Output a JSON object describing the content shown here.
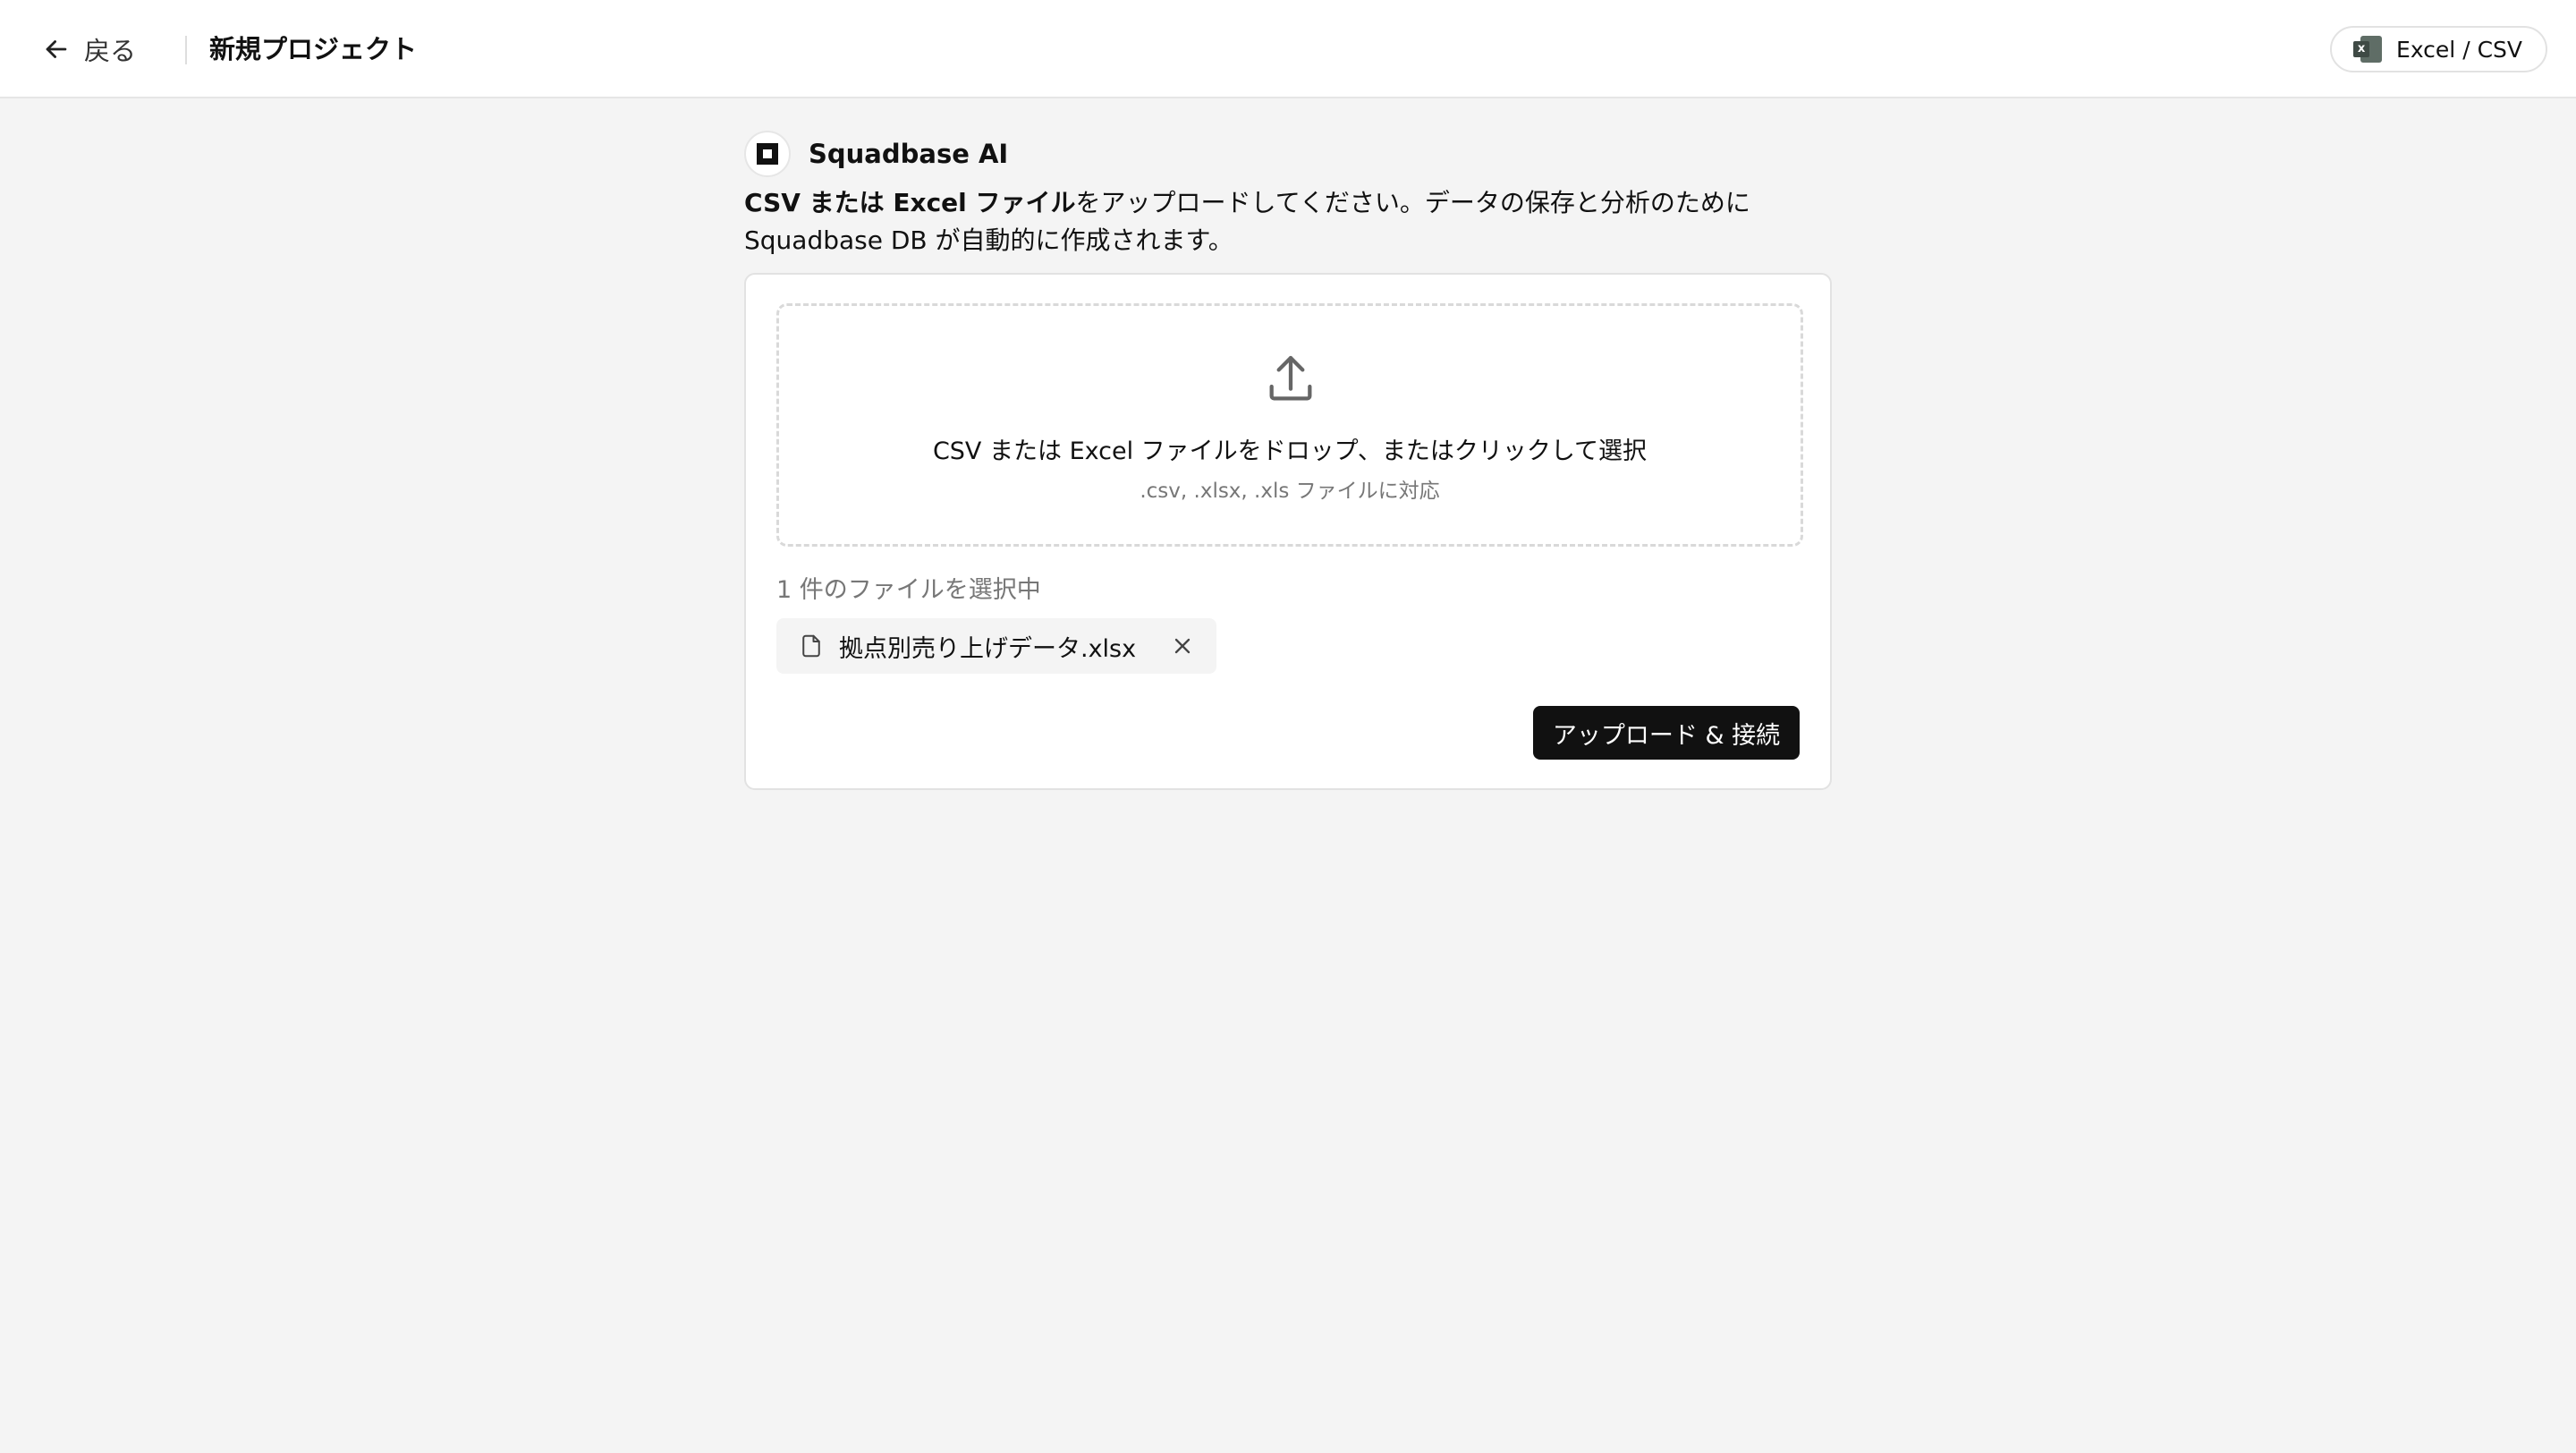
{
  "header": {
    "back_label": "戻る",
    "title": "新規プロジェクト",
    "source_chip": {
      "label": "Excel / CSV",
      "icon": "excel-icon"
    }
  },
  "assistant": {
    "name": "Squadbase AI",
    "message_bold": "CSV または Excel ファイル",
    "message_rest_line1": "をアップロードしてください。データの保存と分析のために",
    "message_line2": "Squadbase DB が自動的に作成されます。"
  },
  "upload": {
    "dropzone_main": "CSV または Excel ファイルをドロップ、またはクリックして選択",
    "dropzone_sub": ".csv, .xlsx, .xls ファイルに対応",
    "selected_count_text": "1 件のファイルを選択中",
    "files": [
      {
        "name": "拠点別売り上げデータ.xlsx",
        "icon": "file-icon"
      }
    ],
    "submit_label": "アップロード & 接続"
  },
  "colors": {
    "background": "#f4f4f4",
    "surface": "#ffffff",
    "primary_button": "#111111",
    "muted_text": "#777777"
  }
}
